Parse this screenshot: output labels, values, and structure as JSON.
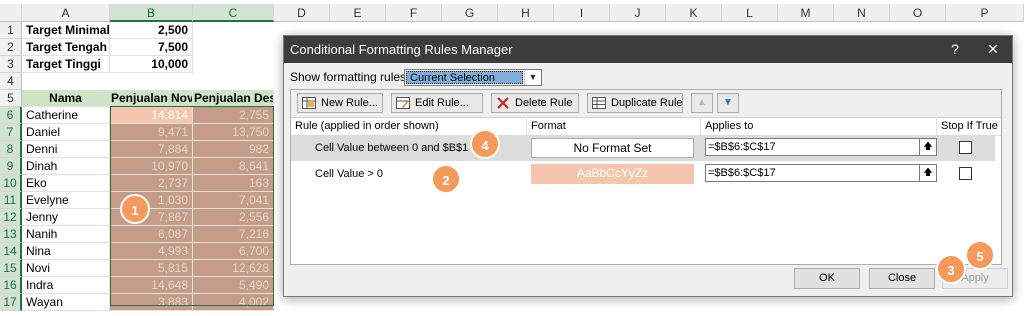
{
  "sheet": {
    "columns": [
      "A",
      "B",
      "C",
      "D",
      "E",
      "F",
      "G",
      "H",
      "I",
      "J",
      "K",
      "L",
      "M",
      "N",
      "O",
      "P"
    ],
    "rows": [
      "1",
      "2",
      "3",
      "4",
      "5",
      "6",
      "7",
      "8",
      "9",
      "10",
      "11",
      "12",
      "13",
      "14",
      "15",
      "16",
      "17"
    ],
    "targets": [
      {
        "label": "Target Minimal",
        "value": "2,500"
      },
      {
        "label": "Target Tengah",
        "value": "7,500"
      },
      {
        "label": "Target Tinggi",
        "value": "10,000"
      }
    ],
    "header": {
      "nama": "Nama",
      "nov": "Penjualan Nov",
      "des": "Penjualan Des"
    },
    "data": [
      {
        "nama": "Catherine",
        "nov": "14,814",
        "des": "2,755"
      },
      {
        "nama": "Daniel",
        "nov": "9,471",
        "des": "13,750"
      },
      {
        "nama": "Denni",
        "nov": "7,884",
        "des": "982"
      },
      {
        "nama": "Dinah",
        "nov": "10,970",
        "des": "8,641"
      },
      {
        "nama": "Eko",
        "nov": "2,737",
        "des": "163"
      },
      {
        "nama": "Evelyne",
        "nov": "1,030",
        "des": "7,041"
      },
      {
        "nama": "Jenny",
        "nov": "7,867",
        "des": "2,556"
      },
      {
        "nama": "Nanih",
        "nov": "6,087",
        "des": "7,216"
      },
      {
        "nama": "Nina",
        "nov": "4,993",
        "des": "6,700"
      },
      {
        "nama": "Novi",
        "nov": "5,815",
        "des": "12,628"
      },
      {
        "nama": "Indra",
        "nov": "14,648",
        "des": "5,490"
      },
      {
        "nama": "Wayan",
        "nov": "3,883",
        "des": "4,002"
      }
    ]
  },
  "dialog": {
    "title": "Conditional Formatting Rules Manager",
    "help": "?",
    "close": "✕",
    "show_label": "Show formatting rules for:",
    "show_value": "Current Selection",
    "buttons": {
      "new": "New Rule...",
      "edit": "Edit Rule...",
      "delete": "Delete Rule",
      "duplicate": "Duplicate Rule"
    },
    "columns": {
      "rule": "Rule (applied in order shown)",
      "format": "Format",
      "applies": "Applies to",
      "stop": "Stop If True"
    },
    "rules": [
      {
        "name": "Cell Value between 0 and $B$1",
        "format": "No Format Set",
        "applies": "=$B$6:$C$17"
      },
      {
        "name": "Cell Value > 0",
        "format": "AaBbCcYyZz",
        "applies": "=$B$6:$C$17"
      }
    ],
    "ok": "OK",
    "close_btn": "Close",
    "apply": "Apply"
  },
  "callouts": [
    "1",
    "2",
    "3",
    "4",
    "5"
  ],
  "colors": {
    "accent": "#217346",
    "rule_fill": "#f6c5ad",
    "callout": "#f59a5a",
    "range_fill": "#c49c88"
  }
}
